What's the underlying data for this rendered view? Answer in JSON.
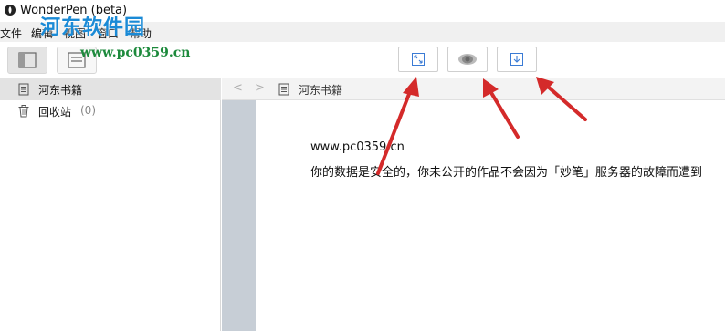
{
  "window": {
    "title": "WonderPen (beta)"
  },
  "menu": {
    "items": [
      "文件",
      "编辑",
      "视图",
      "窗口",
      "帮助"
    ]
  },
  "watermark": {
    "site_name": "河东软件园",
    "url": "www.pc0359.cn"
  },
  "sidebar": {
    "items": [
      {
        "icon": "document-icon",
        "label": "河东书籍",
        "selected": true
      },
      {
        "icon": "trash-icon",
        "label": "回收站",
        "count": "(0)"
      }
    ]
  },
  "editor": {
    "toolbar": {
      "buttons": [
        "fullscreen-icon",
        "preview-eye-icon",
        "export-download-icon"
      ]
    },
    "nav": {
      "back": "<",
      "forward": ">",
      "doc_title": "河东书籍"
    },
    "content": {
      "line1": "www.pc0359.cn",
      "line2": "你的数据是安全的，你未公开的作品不会因为「妙笔」服务器的故障而遭到"
    }
  },
  "colors": {
    "annotation_arrow": "#d42a2a",
    "gutter": "#c7ced6",
    "watermark_blue": "#1a8ad6",
    "watermark_green": "#1d8a3c"
  }
}
